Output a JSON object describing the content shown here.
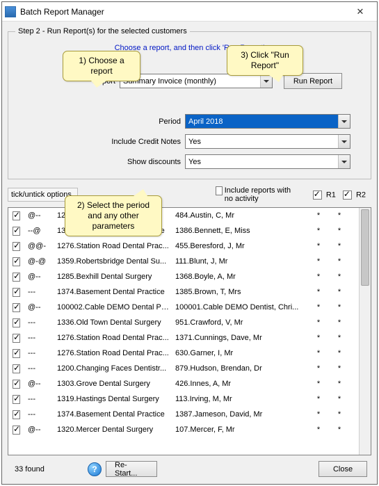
{
  "window": {
    "title": "Batch Report Manager",
    "close_label": "✕"
  },
  "step": {
    "legend": "Step 2 - Run Report(s) for the selected customers",
    "hint": "Choose a report, and then click 'Run Report'",
    "report_label": "Report",
    "report_value": "Summary Invoice (monthly)",
    "run_label": "Run Report",
    "period_label": "Period",
    "period_value": "April 2018",
    "credit_label": "Include Credit Notes",
    "credit_value": "Yes",
    "disc_label": "Show discounts",
    "disc_value": "Yes"
  },
  "callouts": {
    "c1": "1) Choose a report",
    "c2": "2) Select the period and any other parameters",
    "c3": "3) Click \"Run Report\""
  },
  "options": {
    "tick": "tick/untick options",
    "include": "Include reports with no activity",
    "r1": "R1",
    "r2": "R2"
  },
  "rows": [
    {
      "ck": true,
      "flag": "@--",
      "practice": "1285.Bexhill Dental Surgery",
      "person": "484.Austin, C, Mr",
      "r1": "*",
      "r2": "*"
    },
    {
      "ck": true,
      "flag": "--@",
      "practice": "1374.Basement Dental Practice",
      "person": "1386.Bennett, E, Miss",
      "r1": "*",
      "r2": "*"
    },
    {
      "ck": true,
      "flag": "@@-",
      "practice": "1276.Station Road Dental Prac...",
      "person": "455.Beresford, J, Mr",
      "r1": "*",
      "r2": "*"
    },
    {
      "ck": true,
      "flag": "@-@",
      "practice": "1359.Robertsbridge Dental Su...",
      "person": "111.Blunt, J, Mr",
      "r1": "*",
      "r2": "*"
    },
    {
      "ck": true,
      "flag": "@--",
      "practice": "1285.Bexhill Dental Surgery",
      "person": "1368.Boyle, A, Mr",
      "r1": "*",
      "r2": "*"
    },
    {
      "ck": true,
      "flag": "---",
      "practice": "1374.Basement Dental Practice",
      "person": "1385.Brown, T, Mrs",
      "r1": "*",
      "r2": "*"
    },
    {
      "ck": true,
      "flag": "@--",
      "practice": "100002.Cable DEMO Dental Pr...",
      "person": "100001.Cable DEMO Dentist, Chri...",
      "r1": "*",
      "r2": "*"
    },
    {
      "ck": true,
      "flag": "---",
      "practice": "1336.Old Town Dental Surgery",
      "person": "951.Crawford, V, Mr",
      "r1": "*",
      "r2": "*"
    },
    {
      "ck": true,
      "flag": "---",
      "practice": "1276.Station Road Dental Prac...",
      "person": "1371.Cunnings, Dave, Mr",
      "r1": "*",
      "r2": "*"
    },
    {
      "ck": true,
      "flag": "---",
      "practice": "1276.Station Road Dental Prac...",
      "person": "630.Garner, I, Mr",
      "r1": "*",
      "r2": "*"
    },
    {
      "ck": true,
      "flag": "---",
      "practice": "1200.Changing Faces Dentistr...",
      "person": "879.Hudson, Brendan, Dr",
      "r1": "*",
      "r2": "*"
    },
    {
      "ck": true,
      "flag": "@--",
      "practice": "1303.Grove Dental Surgery",
      "person": "426.Innes, A, Mr",
      "r1": "*",
      "r2": "*"
    },
    {
      "ck": true,
      "flag": "---",
      "practice": "1319.Hastings Dental Surgery",
      "person": "113.Irving, M, Mr",
      "r1": "*",
      "r2": "*"
    },
    {
      "ck": true,
      "flag": "---",
      "practice": "1374.Basement Dental Practice",
      "person": "1387.Jameson, David, Mr",
      "r1": "*",
      "r2": "*"
    },
    {
      "ck": true,
      "flag": "@--",
      "practice": "1320.Mercer Dental Surgery",
      "person": "107.Mercer, F, Mr",
      "r1": "*",
      "r2": "*"
    }
  ],
  "footer": {
    "count": "33  found",
    "restart": "Re-Start...",
    "close": "Close"
  }
}
